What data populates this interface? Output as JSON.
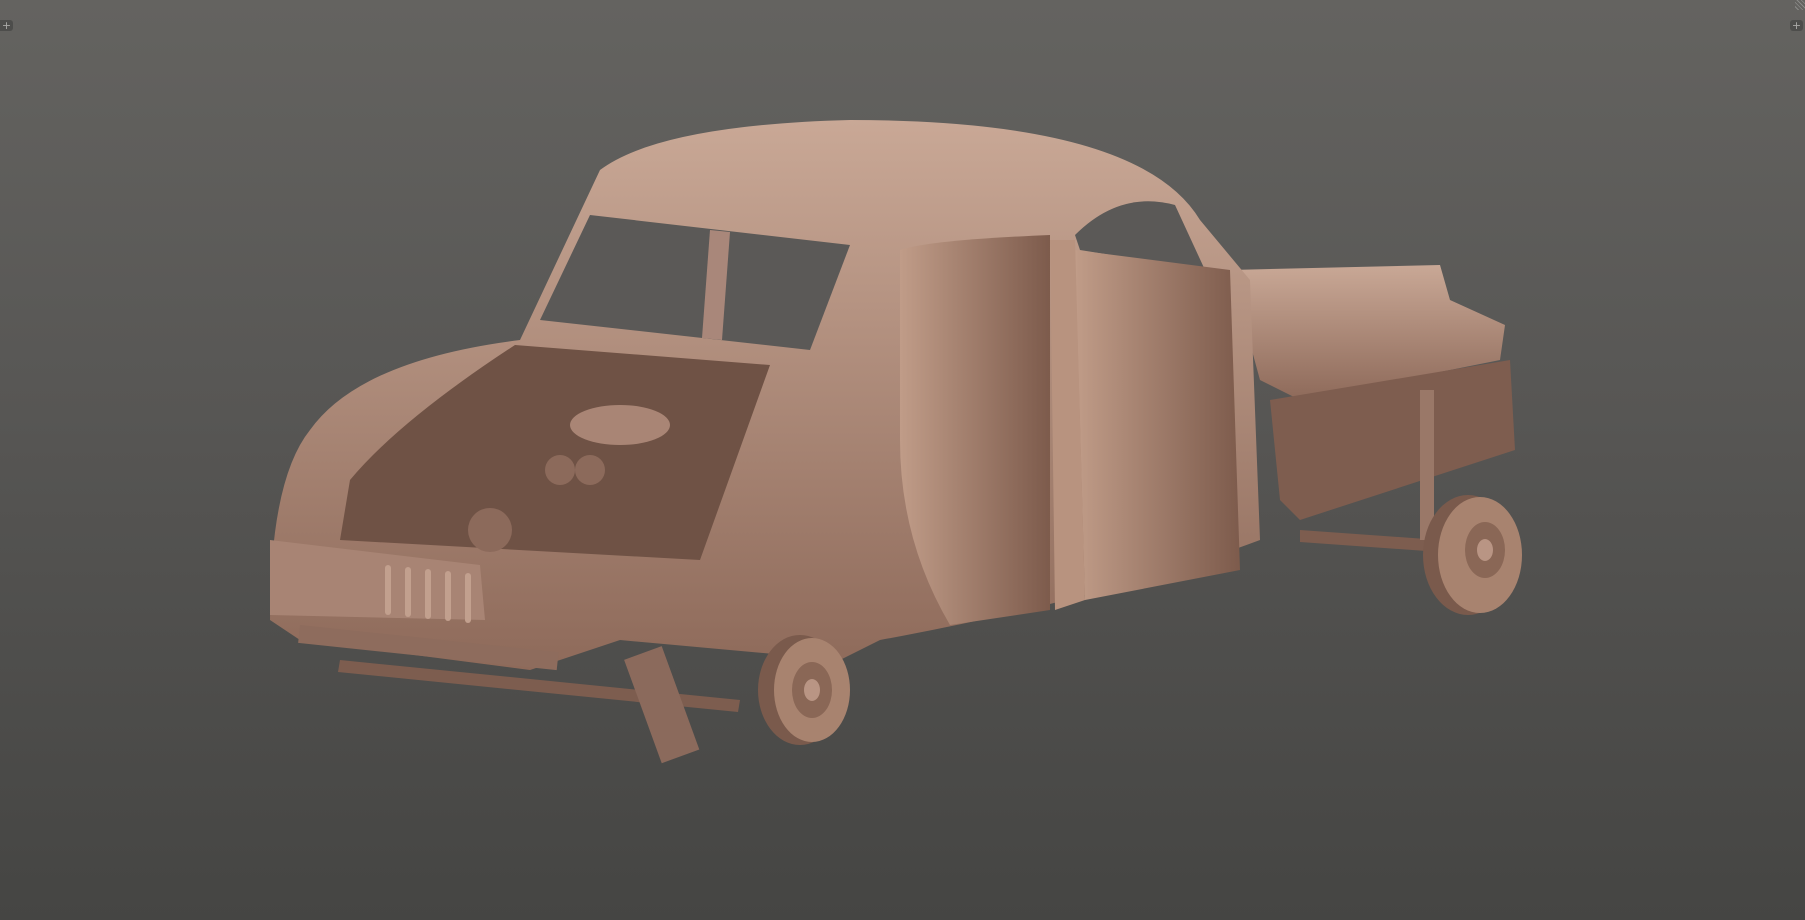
{
  "viewport": {
    "type": "3d-viewport",
    "background_top": "#646360",
    "background_bottom": "#454543",
    "model_color": "#b08b79"
  },
  "controls": {
    "split_left_icon": "plus-icon",
    "split_right_icon": "plus-icon",
    "corner_icon": "resize-corner-icon"
  }
}
